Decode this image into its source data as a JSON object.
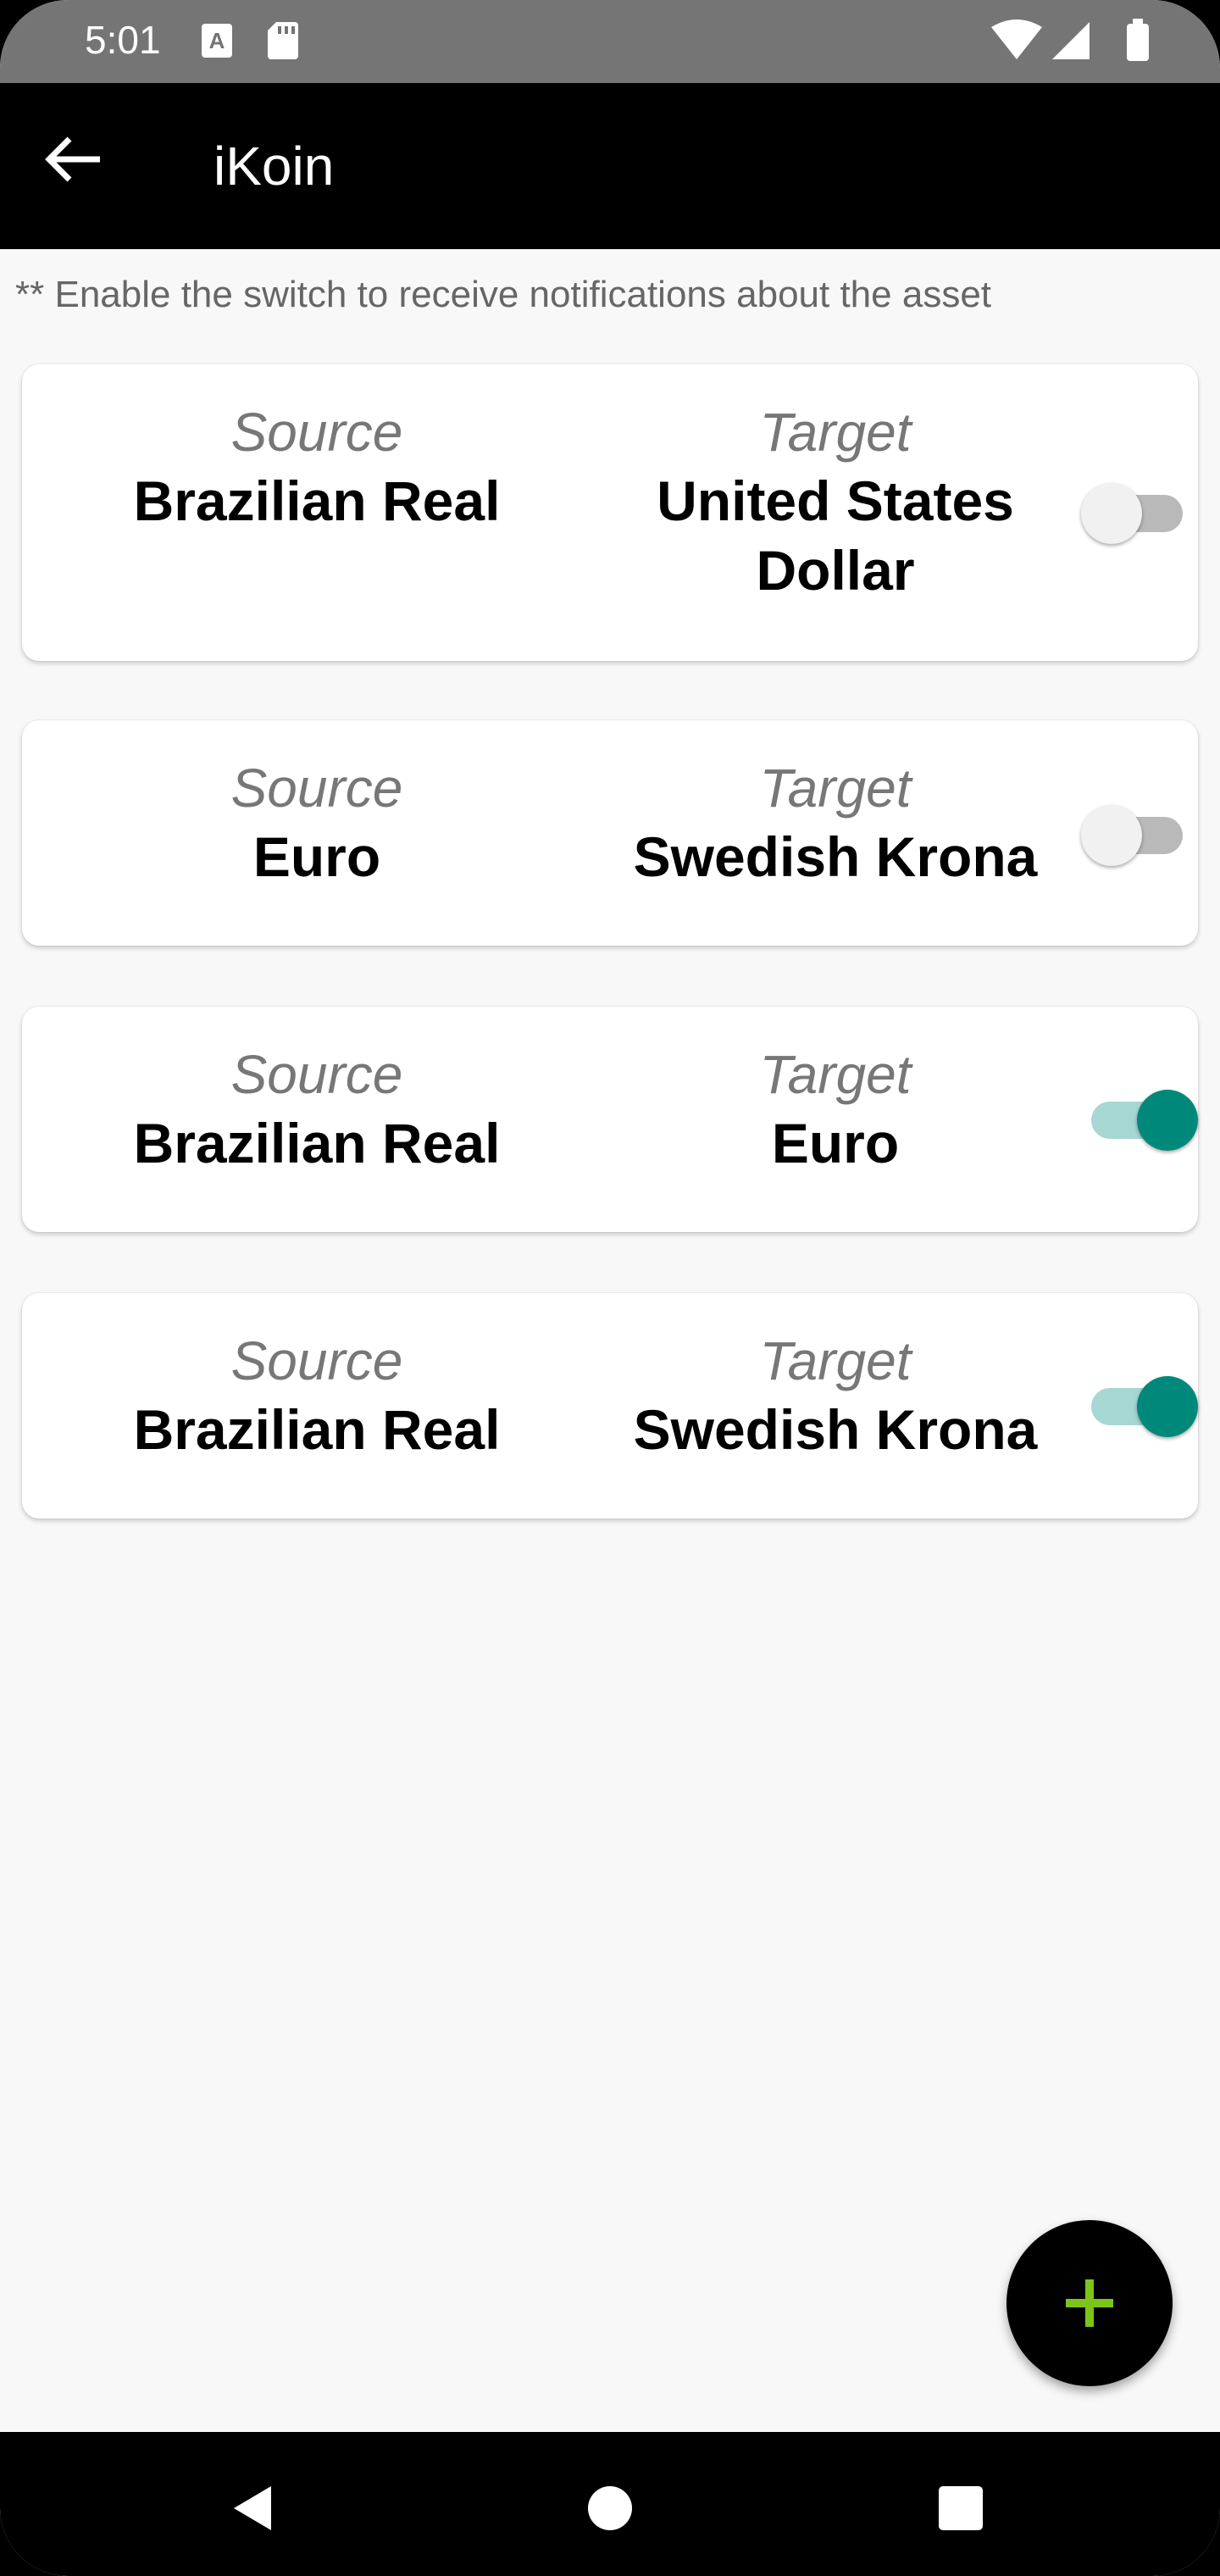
{
  "status_bar": {
    "time": "5:01",
    "icons": [
      "a-notification-icon",
      "sd-card-icon",
      "wifi-icon",
      "signal-icon",
      "battery-icon"
    ]
  },
  "app_bar": {
    "title": "iKoin",
    "back_icon": "arrow-left-icon"
  },
  "hint": "** Enable the switch to receive notifications about the asset",
  "colors": {
    "app_bar": "#000000",
    "status_bar": "#757575",
    "accent": "#00897b",
    "fab_plus": "#7cc41a"
  },
  "pairs": [
    {
      "source_label": "Source",
      "source": "Brazilian Real",
      "target_label": "Target",
      "target": "United States Dollar",
      "notifications_enabled": false
    },
    {
      "source_label": "Source",
      "source": "Euro",
      "target_label": "Target",
      "target": "Swedish Krona",
      "notifications_enabled": false
    },
    {
      "source_label": "Source",
      "source": "Brazilian Real",
      "target_label": "Target",
      "target": "Euro",
      "notifications_enabled": true
    },
    {
      "source_label": "Source",
      "source": "Brazilian Real",
      "target_label": "Target",
      "target": "Swedish Krona",
      "notifications_enabled": true
    }
  ],
  "fab": {
    "icon": "plus-icon"
  },
  "nav_bar": {
    "icons": [
      "back-triangle-icon",
      "home-circle-icon",
      "recents-square-icon"
    ]
  }
}
